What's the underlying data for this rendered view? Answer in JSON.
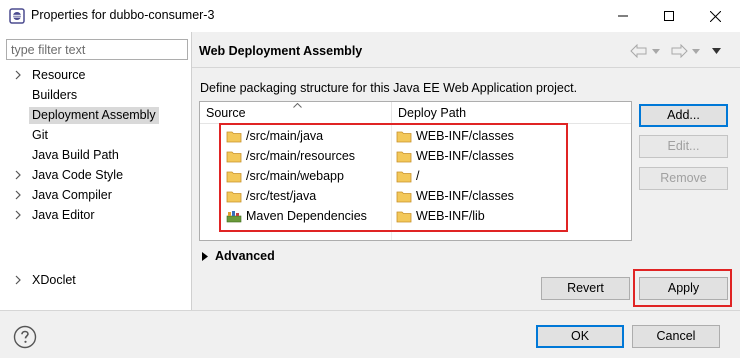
{
  "window": {
    "title": "Properties for dubbo-consumer-3",
    "minimize_glyph": "—",
    "maximize_glyph": "☐",
    "close_glyph": "✕"
  },
  "filter": {
    "placeholder": "type filter text",
    "value": ""
  },
  "tree": {
    "items": [
      {
        "label": "Resource",
        "expandable": true,
        "selected": false
      },
      {
        "label": "Builders",
        "expandable": false,
        "selected": false
      },
      {
        "label": "Deployment Assembly",
        "expandable": false,
        "selected": true
      },
      {
        "label": "Git",
        "expandable": false,
        "selected": false
      },
      {
        "label": "Java Build Path",
        "expandable": false,
        "selected": false
      },
      {
        "label": "Java Code Style",
        "expandable": true,
        "selected": false
      },
      {
        "label": "Java Compiler",
        "expandable": true,
        "selected": false
      },
      {
        "label": "Java Editor",
        "expandable": true,
        "selected": false
      },
      {
        "label": "XDoclet",
        "expandable": true,
        "selected": false
      }
    ]
  },
  "page": {
    "title": "Web Deployment Assembly",
    "description": "Define packaging structure for this Java EE Web Application project."
  },
  "table": {
    "headers": {
      "source": "Source",
      "deploy": "Deploy Path"
    },
    "rows": [
      {
        "source": "/src/main/java",
        "deploy": "WEB-INF/classes",
        "source_icon": "folder-icon"
      },
      {
        "source": "/src/main/resources",
        "deploy": "WEB-INF/classes",
        "source_icon": "folder-icon"
      },
      {
        "source": "/src/main/webapp",
        "deploy": "/",
        "source_icon": "folder-icon"
      },
      {
        "source": "/src/test/java",
        "deploy": "WEB-INF/classes",
        "source_icon": "folder-icon"
      },
      {
        "source": "Maven Dependencies",
        "deploy": "WEB-INF/lib",
        "source_icon": "library-icon"
      }
    ]
  },
  "buttons": {
    "add": "Add...",
    "edit": "Edit...",
    "remove": "Remove",
    "revert": "Revert",
    "apply": "Apply",
    "ok": "OK",
    "cancel": "Cancel"
  },
  "advanced": {
    "label": "Advanced"
  },
  "colors": {
    "highlight": "#e02424",
    "folder": "#e8b33a",
    "default_button_border": "#0078d7"
  }
}
